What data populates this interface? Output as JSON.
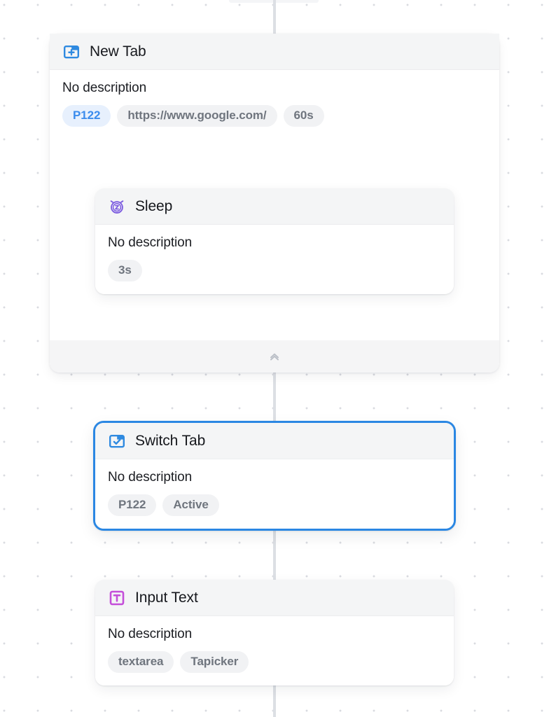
{
  "canvas": {
    "background": "#ffffff",
    "dot_color": "#d9dbe0",
    "connector_color": "#dcdfe4",
    "accent_color": "#2b87e3"
  },
  "group": {
    "collapse_label": "Collapse group",
    "collapse_icon": "chevron-double-up-icon"
  },
  "nodes": [
    {
      "id": "new-tab",
      "title": "New Tab",
      "icon": "new-tab-icon",
      "icon_color": "#2f8ae0",
      "description": "No description",
      "selected": false,
      "tags": [
        {
          "label": "P122",
          "style": "accent"
        },
        {
          "label": "https://www.google.com/",
          "style": "default"
        },
        {
          "label": "60s",
          "style": "default"
        }
      ]
    },
    {
      "id": "sleep",
      "title": "Sleep",
      "icon": "alarm-sleep-icon",
      "icon_color": "#7c5ce0",
      "description": "No description",
      "selected": false,
      "tags": [
        {
          "label": "3s",
          "style": "default"
        }
      ]
    },
    {
      "id": "switch-tab",
      "title": "Switch Tab",
      "icon": "switch-tab-icon",
      "icon_color": "#2f8ae0",
      "description": "No description",
      "selected": true,
      "tags": [
        {
          "label": "P122",
          "style": "default"
        },
        {
          "label": "Active",
          "style": "default"
        }
      ]
    },
    {
      "id": "input-text",
      "title": "Input Text",
      "icon": "input-text-icon",
      "icon_color": "#c martin",
      "description": "No description",
      "selected": false,
      "tags": [
        {
          "label": "textarea",
          "style": "default"
        },
        {
          "label": "Tapicker",
          "style": "default"
        }
      ]
    }
  ]
}
